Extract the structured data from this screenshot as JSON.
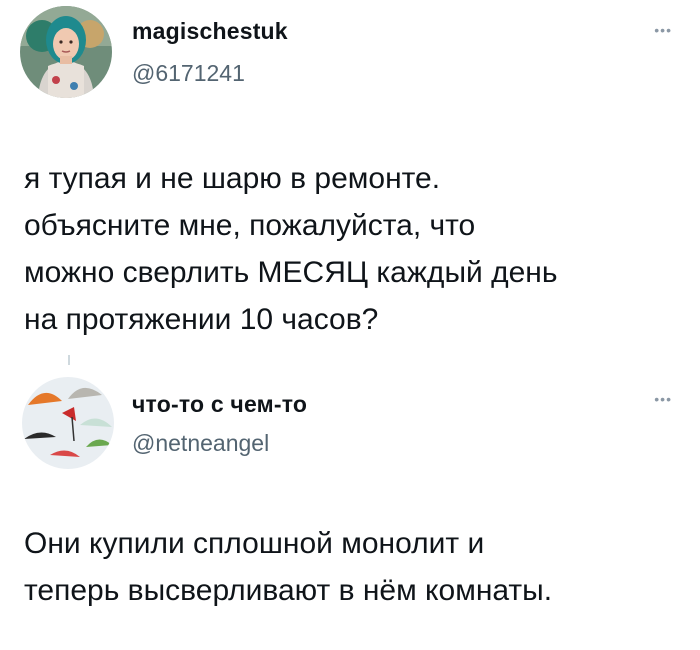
{
  "tweets": [
    {
      "display_name": "magischestuk",
      "handle": "@6171241",
      "more_icon": "more-dots-icon",
      "text": "я тупая и не шарю в ремонте.\nобъясните мне, пожалуйста, что\nможно сверлить МЕСЯЦ каждый день\nна протяжении 10 часов?"
    },
    {
      "display_name": "что-то с чем-то",
      "handle": "@netneangel",
      "more_icon": "more-dots-icon",
      "text": "Они купили сплошной монолит и\nтеперь высверливают в нём комнаты."
    }
  ]
}
